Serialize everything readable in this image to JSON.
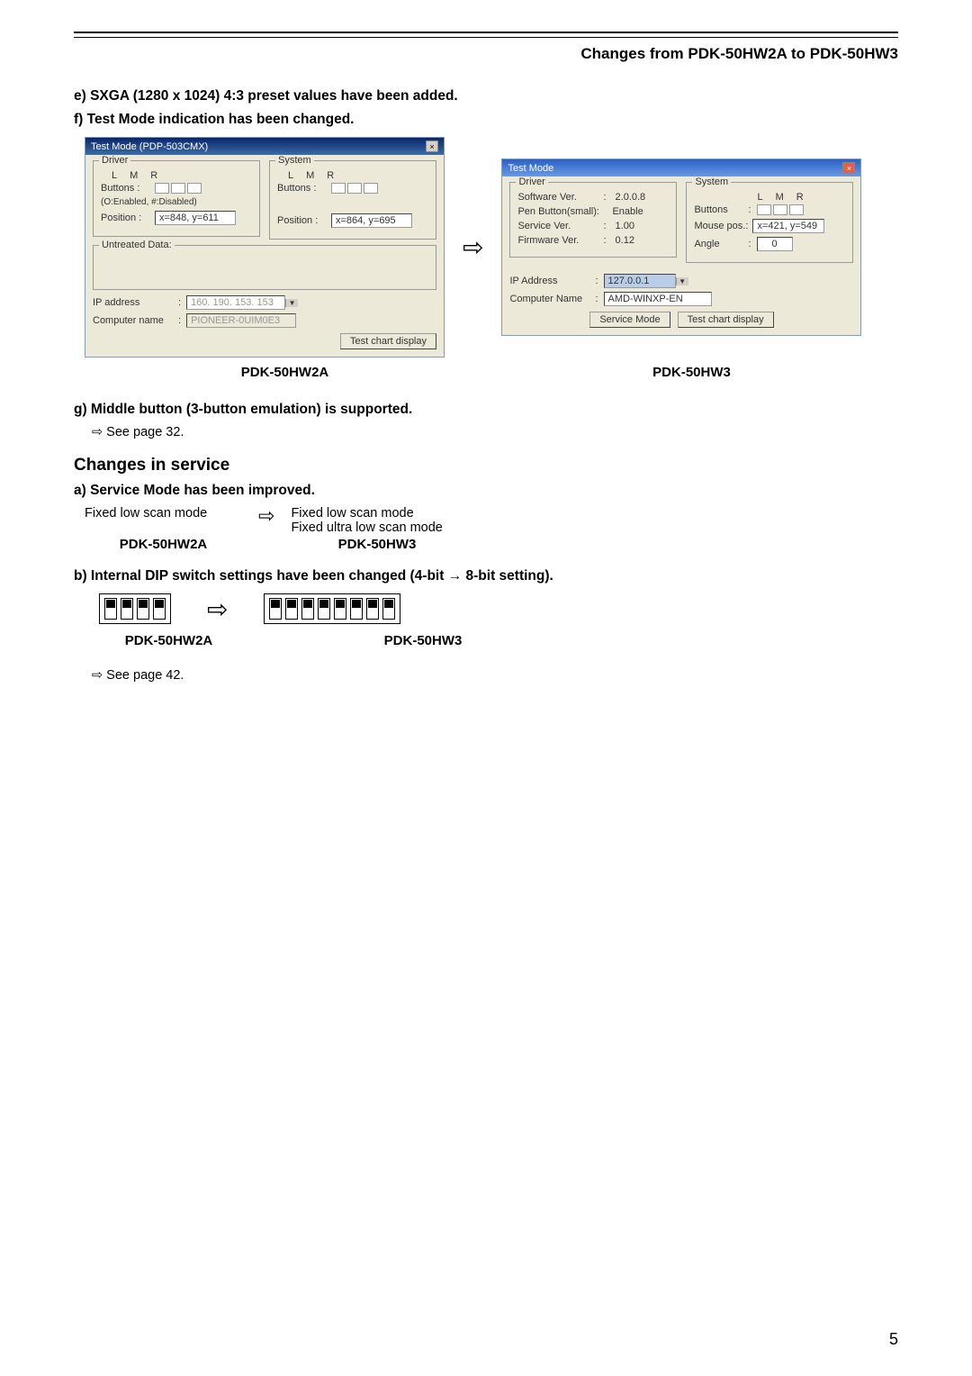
{
  "header": {
    "title": "Changes from PDK-50HW2A to PDK-50HW3"
  },
  "items": {
    "e": "e) SXGA (1280 x 1024) 4:3 preset values have been added.",
    "f": "f) Test Mode indication has been changed.",
    "g": "g) Middle button (3-button emulation) is supported.",
    "g_see": "⇨ See page 32."
  },
  "dlg1": {
    "title": "Test Mode (PDP-503CMX)",
    "driver_label": "Driver",
    "system_label": "System",
    "lmr_l": "L",
    "lmr_m": "M",
    "lmr_r": "R",
    "buttons_label": "Buttons :",
    "enabled_note": "(O:Enabled, #:Disabled)",
    "position_label": "Position :",
    "pos_driver": "x=848, y=611",
    "pos_system": "x=864, y=695",
    "untreated_label": "Untreated Data:",
    "ip_label": "IP address",
    "ip_value": "160. 190. 153. 153",
    "comp_label": "Computer name",
    "comp_value": "PIONEER-0UIM0E3",
    "test_chart_btn": "Test chart display"
  },
  "dlg2": {
    "title": "Test Mode",
    "driver_label": "Driver",
    "system_label": "System",
    "lmr_l": "L",
    "lmr_m": "M",
    "lmr_r": "R",
    "sw_label": "Software Ver.",
    "sw_val": "2.0.0.8",
    "pen_label": "Pen Button(small):",
    "pen_val": "Enable",
    "svc_label": "Service Ver.",
    "svc_val": "1.00",
    "fw_label": "Firmware Ver.",
    "fw_val": "0.12",
    "buttons_label": "Buttons",
    "mouse_label": "Mouse pos.:",
    "mouse_val": "x=421, y=549",
    "angle_label": "Angle",
    "angle_val": "0",
    "ip_label": "IP Address",
    "ip_value": "127.0.0.1",
    "comp_label": "Computer Name",
    "comp_value": "AMD-WINXP-EN",
    "svc_mode_btn": "Service Mode",
    "test_chart_btn": "Test chart display"
  },
  "caption": {
    "left": "PDK-50HW2A",
    "right": "PDK-50HW3"
  },
  "service": {
    "h2": "Changes in service",
    "a": "a) Service Mode has been improved.",
    "left_mode": "Fixed low scan mode",
    "right_mode1": "Fixed low scan mode",
    "right_mode2": "Fixed ultra low scan mode",
    "cap_left": "PDK-50HW2A",
    "cap_right": "PDK-50HW3",
    "b": "b) Internal DIP switch settings have been changed (4-bit → 8-bit setting).",
    "dip_cap_left": "PDK-50HW2A",
    "dip_cap_right": "PDK-50HW3",
    "see42": "⇨ See page 42."
  },
  "page_num": "5",
  "arrow": "⇨"
}
